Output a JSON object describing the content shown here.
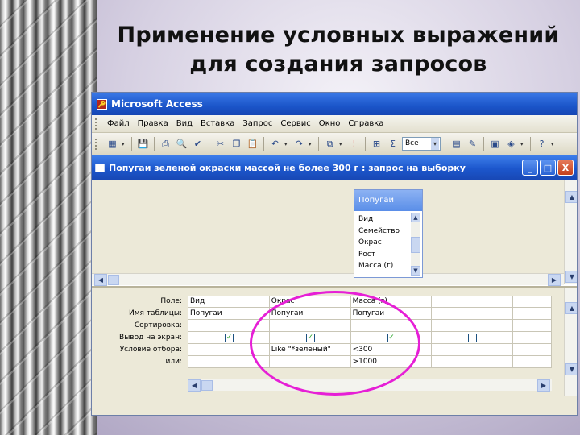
{
  "slide": {
    "title_line1": "Применение условных выражений",
    "title_line2": "для создания запросов"
  },
  "app": {
    "title": "Microsoft Access",
    "menu": [
      "Файл",
      "Правка",
      "Вид",
      "Вставка",
      "Запрос",
      "Сервис",
      "Окно",
      "Справка"
    ],
    "toolbar": {
      "combo_value": "Все",
      "icons": [
        "view-icon",
        "save-icon",
        "print-icon",
        "preview-icon",
        "spell-icon",
        "cut-icon",
        "copy-icon",
        "paste-icon",
        "undo-icon",
        "redo-icon",
        "query-type-icon",
        "run-icon",
        "show-table-icon",
        "sum-icon",
        "properties-icon",
        "build-icon",
        "database-icon",
        "new-object-icon",
        "help-icon"
      ]
    }
  },
  "query_window": {
    "title": "Попугаи зеленой окраски массой не более 300 г : запрос на выборку",
    "buttons": {
      "minimize": "_",
      "maximize": "□",
      "close": "X"
    }
  },
  "field_list": {
    "title": "Попугаи",
    "fields": [
      "Вид",
      "Семейство",
      "Окрас",
      "Рост",
      "Масса (г)"
    ]
  },
  "design_grid": {
    "row_labels": [
      "Поле:",
      "Имя таблицы:",
      "Сортировка:",
      "Вывод на экран:",
      "Условие отбора:",
      "или:"
    ],
    "columns": [
      {
        "field": "Вид",
        "table": "Попугаи",
        "sort": "",
        "show": true,
        "criteria": "",
        "or": ""
      },
      {
        "field": "Окрас",
        "table": "Попугаи",
        "sort": "",
        "show": true,
        "criteria": "Like \"*зеленый\"",
        "or": ""
      },
      {
        "field": "Масса (г)",
        "table": "Попугаи",
        "sort": "",
        "show": true,
        "criteria": "<300",
        "or": ">1000"
      },
      {
        "field": "",
        "table": "",
        "sort": "",
        "show": false,
        "criteria": "",
        "or": ""
      }
    ]
  },
  "colors": {
    "highlight": "#e61fd6",
    "titlebar": "#1b55c9",
    "checkmark": "#21a121"
  }
}
